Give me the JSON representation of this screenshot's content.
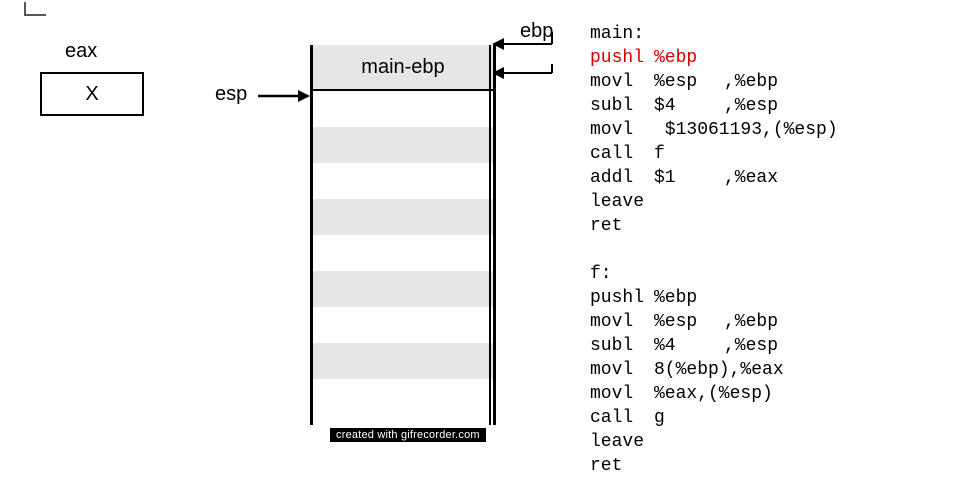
{
  "register": {
    "name": "eax",
    "value": "X"
  },
  "pointers": {
    "esp_label": "esp",
    "ebp_label": "ebp"
  },
  "stack": {
    "top_cell": "main-ebp"
  },
  "watermark": "created with gifrecorder.com",
  "code": {
    "main_label": "main:",
    "f_label": "f:",
    "main": [
      {
        "op": "pushl",
        "a1": "%ebp",
        "a2": "",
        "hl": true
      },
      {
        "op": "movl",
        "a1": "%esp",
        "a2": ",%ebp",
        "hl": false
      },
      {
        "op": "subl",
        "a1": "$4",
        "a2": ",%esp",
        "hl": false
      },
      {
        "op": "movl",
        "a1": " $13061193,(%esp)",
        "a2": "",
        "hl": false
      },
      {
        "op": "call",
        "a1": "f",
        "a2": "",
        "hl": false
      },
      {
        "op": "addl",
        "a1": "$1",
        "a2": ",%eax",
        "hl": false
      },
      {
        "op": "leave",
        "a1": "",
        "a2": "",
        "hl": false
      },
      {
        "op": "ret",
        "a1": "",
        "a2": "",
        "hl": false
      }
    ],
    "f": [
      {
        "op": "pushl",
        "a1": "%ebp",
        "a2": "",
        "hl": false
      },
      {
        "op": "movl",
        "a1": "%esp",
        "a2": ",%ebp",
        "hl": false
      },
      {
        "op": "subl",
        "a1": "%4",
        "a2": ",%esp",
        "hl": false
      },
      {
        "op": "movl",
        "a1": "8(%ebp),%eax",
        "a2": "",
        "hl": false
      },
      {
        "op": "movl",
        "a1": "%eax,(%esp)",
        "a2": "",
        "hl": false
      },
      {
        "op": "call",
        "a1": "g",
        "a2": "",
        "hl": false
      },
      {
        "op": "leave",
        "a1": "",
        "a2": "",
        "hl": false
      },
      {
        "op": "ret",
        "a1": "",
        "a2": "",
        "hl": false
      }
    ]
  }
}
